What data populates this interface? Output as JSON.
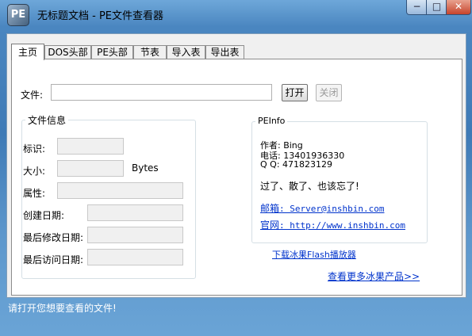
{
  "window": {
    "title": "无标题文档 - PE文件查看器",
    "icon_text": "PE",
    "min_glyph": "−",
    "max_glyph": "□",
    "close_glyph": "✕"
  },
  "tabs": [
    {
      "label": "主页",
      "active": true
    },
    {
      "label": "DOS头部",
      "active": false
    },
    {
      "label": "PE头部",
      "active": false
    },
    {
      "label": "节表",
      "active": false
    },
    {
      "label": "导入表",
      "active": false
    },
    {
      "label": "导出表",
      "active": false
    }
  ],
  "file_row": {
    "label": "文件:",
    "value": "",
    "open_button": "打开",
    "close_button": "关闭"
  },
  "file_info": {
    "title": "文件信息",
    "fields": [
      {
        "label": "标识:",
        "value": ""
      },
      {
        "label": "大小:",
        "value": "",
        "unit": "Bytes"
      },
      {
        "label": "属性:",
        "value": ""
      },
      {
        "label": "创建日期:",
        "value": ""
      },
      {
        "label": "最后修改日期:",
        "value": ""
      },
      {
        "label": "最后访问日期:",
        "value": ""
      }
    ]
  },
  "pe_info": {
    "title": "PEInfo",
    "author": "作者: Bing",
    "phone": "电话: 13401936330",
    "qq": "Q Q: 471823129",
    "slogan": "过了、散了、也该忘了!",
    "email_label": "邮箱",
    "email_value": ": Server@inshbin.com",
    "site_label": "官网",
    "site_value": ": http://www.inshbin.com"
  },
  "links": {
    "download": "下载冰果Flash播放器",
    "more": "查看更多冰果产品>>"
  },
  "status": "请打开您想要查看的文件!"
}
